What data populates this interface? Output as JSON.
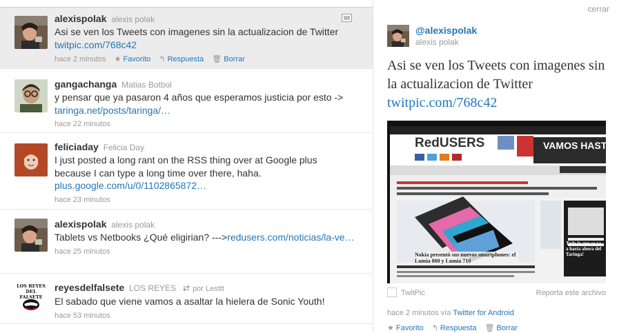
{
  "timeline": {
    "tweets": [
      {
        "handle": "alexispolak",
        "name": "alexis polak",
        "text": "Asi se ven los Tweets con imagenes sin la actualizacion de Twitter",
        "link": "twitpic.com/768c42",
        "time": "hace 2 minutos",
        "actions": {
          "favorite": "Favorito",
          "reply": "Respuesta",
          "delete": "Borrar"
        },
        "has_media_icon": true
      },
      {
        "handle": "gangachanga",
        "name": "Matias Botbol",
        "text": "y pensar que ya pasaron 4 años que esperamos justicia por esto ->",
        "link": "taringa.net/posts/taringa/…",
        "time": "hace 22 minutos"
      },
      {
        "handle": "feliciaday",
        "name": "Felicia Day",
        "text": "I just posted a long rant on the RSS thing over at Google plus because I can type a long time over there, haha.",
        "link": "plus.google.com/u/0/1102865872…",
        "time": "hace 23 minutos"
      },
      {
        "handle": "alexispolak",
        "name": "alexis polak",
        "text": "Tablets vs Netbooks ¿Qué eligirian? --->",
        "link": "redusers.com/noticias/la-ve…",
        "time": "hace 25 minutos"
      },
      {
        "handle": "reyesdelfalsete",
        "name": "LOS REYES",
        "retweeted_by": "por Lesttt",
        "text": "El sabado que viene vamos a asaltar la hielera de Sonic Youth!",
        "link": "",
        "time": "hace 53 minutos",
        "avatar_logo_text": [
          "LOS REYES",
          "DEL FALSETE"
        ]
      }
    ]
  },
  "detail": {
    "close": "cerrar",
    "handle": "@alexispolak",
    "name": "alexis polak",
    "text": "Asi se ven los Tweets con imagenes sin la actualizacion de Twitter",
    "link": "twitpic.com/768c42",
    "image": {
      "site_logo": "RedUSERS",
      "headline": "Nokia presentó sus nuevos smartphones: el Lumia 800 y Lumia 710",
      "banner": "VAMOS HASTA",
      "side_text": "Todo lo que se va a hasta ahora del Taringa!"
    },
    "source": "TwitPic",
    "report": "Reporta este archivo",
    "time": "hace 2 minutos",
    "via": "vía",
    "client": "Twitter for Android",
    "actions": {
      "favorite": "Favorito",
      "reply": "Respuesta",
      "delete": "Borrar"
    }
  }
}
